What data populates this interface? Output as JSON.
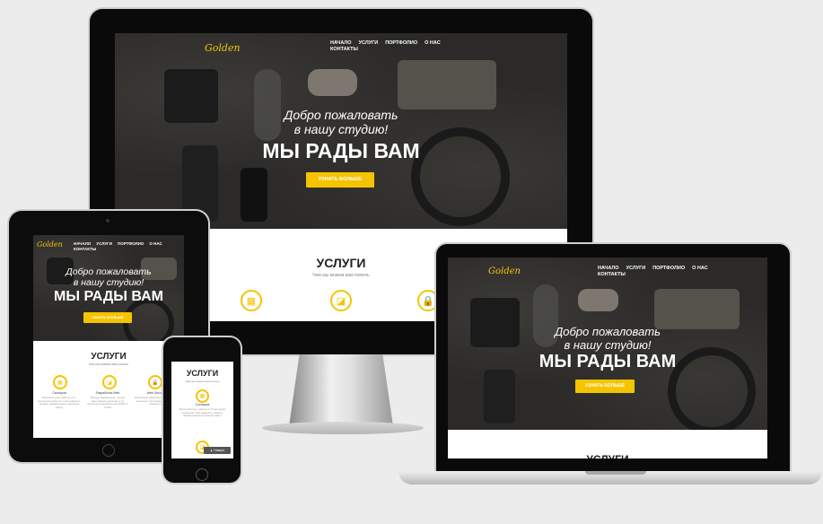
{
  "site": {
    "logo": "Golden",
    "nav": [
      "НАЧАЛО",
      "УСЛУГИ",
      "ПОРТФОЛИО",
      "О НАС",
      "КОНТАКТЫ"
    ],
    "welcome_line1": "Добро пожаловать",
    "welcome_line2": "в нашу студию!",
    "headline": "МЫ РАДЫ ВАМ",
    "cta": "УЗНАТЬ БОЛЬШЕ",
    "services_title": "УСЛУГИ",
    "services_subtitle": "Чем мы можем вам помочь",
    "features": [
      {
        "name": "Скопиров",
        "desc": "Большой опыт работы в IT-сектором позволяет нам заверить, решать эффективные проекции сайты"
      },
      {
        "name": "Разработка Web",
        "desc": "Всегда правильные, четкие адаптивные решения и не используя рекурсию на HTML5 и CSS3"
      },
      {
        "name": "Web Security",
        "desc": "Реализуем разработку по FTP для реальных Аутсорсинг доступа к данным на"
      }
    ],
    "phone_button": "Наверх"
  },
  "colors": {
    "accent": "#f5c400",
    "dark": "#2b2a28"
  }
}
